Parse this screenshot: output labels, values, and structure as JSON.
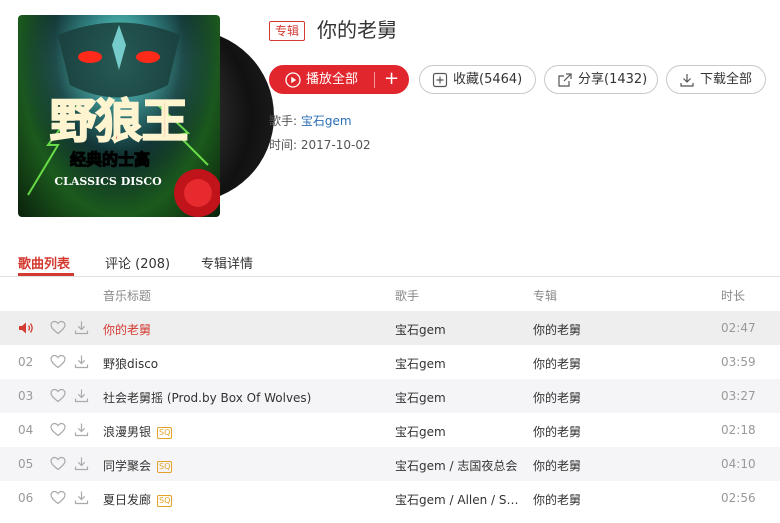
{
  "album": {
    "type_badge": "专辑",
    "title": "你的老舅",
    "artist_label": "歌手: ",
    "artist": "宝石gem",
    "date_label": "时间: ",
    "date": "2017-10-02",
    "cover_art_text": {
      "big": "野狼王",
      "sub": "经典的士高",
      "en": "CLASSICS DISCO"
    }
  },
  "actions": {
    "play_all": "播放全部",
    "add": "+",
    "favorite": "收藏(5464)",
    "share": "分享(1432)",
    "download_all": "下载全部"
  },
  "tabs": {
    "songs": "歌曲列表",
    "comments": "评论",
    "comments_count": "(208)",
    "detail": "专辑详情"
  },
  "table": {
    "headers": {
      "title": "音乐标题",
      "artist": "歌手",
      "album": "专辑",
      "duration": "时长"
    },
    "rows": [
      {
        "index": "",
        "title": "你的老舅",
        "sq": "",
        "artist": "宝石gem",
        "album": "你的老舅",
        "duration": "02:47",
        "playing": true
      },
      {
        "index": "02",
        "title": "野狼disco",
        "sq": "",
        "artist": "宝石gem",
        "album": "你的老舅",
        "duration": "03:59",
        "playing": false
      },
      {
        "index": "03",
        "title": "社会老舅摇 (Prod.by Box Of Wolves)",
        "sq": "",
        "artist": "宝石gem",
        "album": "你的老舅",
        "duration": "03:27",
        "playing": false
      },
      {
        "index": "04",
        "title": "浪漫男银",
        "sq": "SQ",
        "artist": "宝石gem",
        "album": "你的老舅",
        "duration": "02:18",
        "playing": false
      },
      {
        "index": "05",
        "title": "同学聚会",
        "sq": "SQ",
        "artist": "宝石gem / 志国夜总会",
        "album": "你的老舅",
        "duration": "04:10",
        "playing": false
      },
      {
        "index": "06",
        "title": "夏日发廊",
        "sq": "SQ",
        "artist": "宝石gem / Allen / Sup...",
        "album": "你的老舅",
        "duration": "02:56",
        "playing": false
      }
    ]
  },
  "colors": {
    "accent": "#d33a31",
    "play_button": "#e1272d",
    "link": "#2b6fb6",
    "sq_badge": "#e4a128"
  }
}
